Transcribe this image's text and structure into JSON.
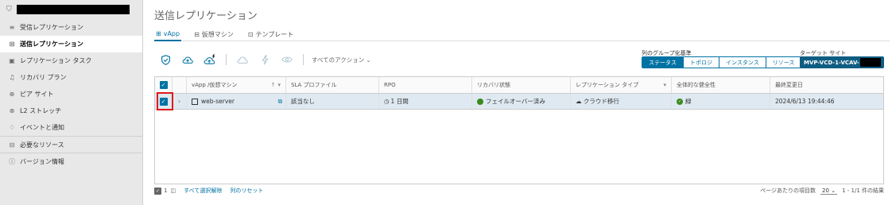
{
  "sidebar": {
    "items": [
      {
        "label": "受信レプリケーション",
        "icon": "inbox-icon",
        "glyph": "≡"
      },
      {
        "label": "送信レプリケーション",
        "icon": "outbox-icon",
        "glyph": "⊞"
      },
      {
        "label": "レプリケーション タスク",
        "icon": "task-icon",
        "glyph": "▣"
      },
      {
        "label": "リカバリ プラン",
        "icon": "plan-icon",
        "glyph": "♫"
      },
      {
        "label": "ピア サイト",
        "icon": "peer-icon",
        "glyph": "⊕"
      },
      {
        "label": "L2 ストレッチ",
        "icon": "stretch-icon",
        "glyph": "⊗"
      },
      {
        "label": "イベントと通知",
        "icon": "bell-icon",
        "glyph": "♢"
      },
      {
        "label": "必要なリソース",
        "icon": "resource-icon",
        "glyph": "⊟"
      },
      {
        "label": "バージョン情報",
        "icon": "info-icon",
        "glyph": "ⓘ"
      }
    ]
  },
  "page": {
    "title": "送信レプリケーション"
  },
  "tabs": [
    {
      "label": "vApp",
      "glyph": "⊞"
    },
    {
      "label": "仮想マシン",
      "glyph": "⊟"
    },
    {
      "label": "テンプレート",
      "glyph": "⊡"
    }
  ],
  "toolbar": {
    "all_actions": "すべてのアクション"
  },
  "group_by": {
    "label": "列のグループ化基準",
    "options": [
      "ステータス",
      "トポロジ",
      "インスタンス",
      "リソース"
    ],
    "selected": "ステータス"
  },
  "target_site": {
    "label": "ターゲット サイト",
    "value": "MVP-VCD-1-VCAV-"
  },
  "grid": {
    "headers": {
      "name": "vApp /仮想マシン",
      "sla": "SLA プロファイル",
      "rpo": "RPO",
      "recovery": "リカバリ状態",
      "type": "レプリケーション タイプ",
      "health": "全体的な健全性",
      "modified": "最終変更日"
    },
    "rows": [
      {
        "name": "web-server",
        "sla": "該当なし",
        "rpo": "1 日間",
        "recovery": "フェイルオーバー済み",
        "type": "クラウド移行",
        "health": "緑",
        "modified": "2024/6/13 19:44:46"
      }
    ]
  },
  "footer": {
    "selected_count": "1",
    "deselect_all": "すべて選択解除",
    "reset_columns": "列のリセット",
    "per_page_label": "ページあたりの項目数",
    "per_page": "20",
    "range": "1 - 1/1 件の結果"
  },
  "colors": {
    "accent": "#0072a3",
    "success": "#3a8a1e",
    "highlight": "#e01b1b"
  }
}
